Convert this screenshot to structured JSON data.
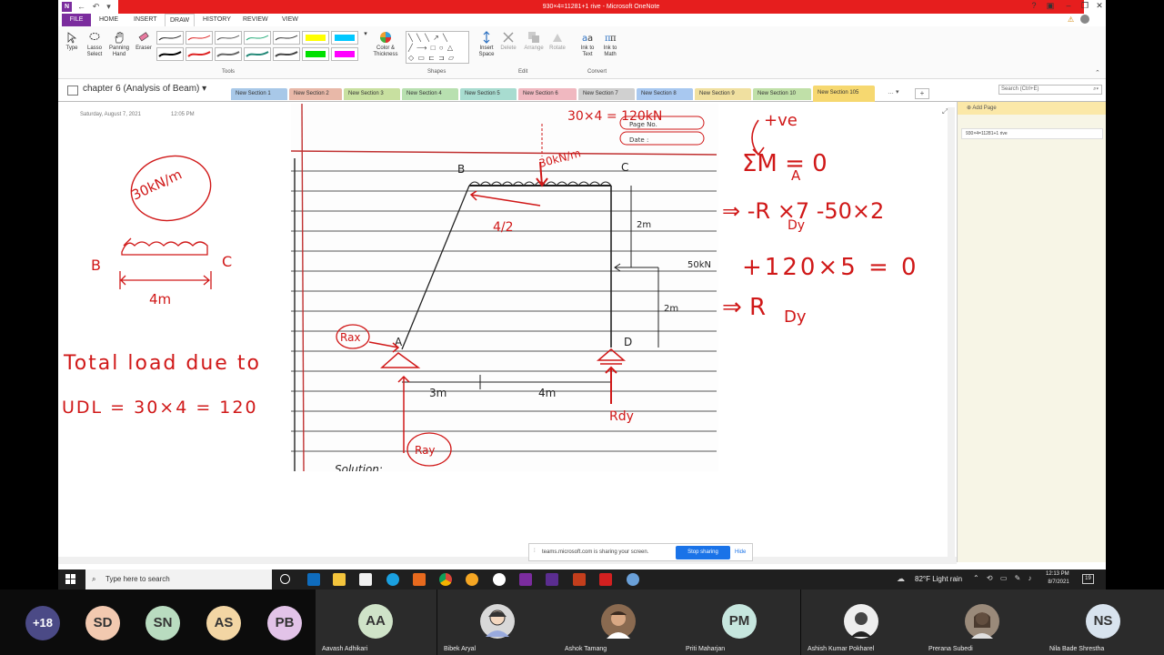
{
  "window": {
    "title": "930×4=11281+1 rive - Microsoft OneNote"
  },
  "ribbon": {
    "tabs": [
      "FILE",
      "HOME",
      "INSERT",
      "DRAW",
      "HISTORY",
      "REVIEW",
      "VIEW"
    ],
    "active_tab": "DRAW",
    "tools": {
      "type": "Type",
      "lasso": "Lasso Select",
      "panning": "Panning Hand",
      "eraser": "Eraser",
      "color_thickness": "Color & Thickness",
      "group": "Tools"
    },
    "shapes_group": "Shapes",
    "edit": {
      "insert_space": "Insert Space",
      "delete": "Delete",
      "arrange": "Arrange",
      "rotate": "Rotate",
      "group": "Edit"
    },
    "convert": {
      "ink_to_text": "Ink to Text",
      "ink_to_math": "Ink to Math",
      "group": "Convert"
    },
    "highlighter_colors": [
      "#ffff00",
      "#00c8ff",
      "#00e000",
      "#ff00ff"
    ]
  },
  "notebook": {
    "title": "chapter 6 (Analysis of Beam)",
    "sections": [
      {
        "label": "New Section 1",
        "color": "#a8c8e8"
      },
      {
        "label": "New Section 2",
        "color": "#e8b8a8"
      },
      {
        "label": "New Section 3",
        "color": "#c8e0a0"
      },
      {
        "label": "New Section 4",
        "color": "#b8e0b0"
      },
      {
        "label": "New Section 5",
        "color": "#a8dcd0"
      },
      {
        "label": "New Section 6",
        "color": "#f0b8c0"
      },
      {
        "label": "New Section 7",
        "color": "#d0d0d0"
      },
      {
        "label": "New Section 8",
        "color": "#a8c8f0"
      },
      {
        "label": "New Section 9",
        "color": "#f0e0a0"
      },
      {
        "label": "New Section 10",
        "color": "#c0e0a8"
      },
      {
        "label": "New Section 105",
        "color": "#f6d870"
      }
    ],
    "search_placeholder": "Search (Ctrl+E)"
  },
  "page": {
    "date": "Saturday, August 7, 2021",
    "time": "12:05 PM",
    "add_page": "Add Page",
    "page_item": "930×4=11281+1 rive"
  },
  "ink_notes": {
    "udl_label": "30kN/m",
    "b": "B",
    "c": "C",
    "span": "4m",
    "total_line1": "Total load due to",
    "total_line2": "UDL = 30×4 = 120",
    "eq1": "+ve",
    "eq2": "ΣM = 0",
    "eq2_sub": "A",
    "eq3": "⇒ -R  ×7 -50×2",
    "eq3_sub": "Dy",
    "eq4": "+120×5 = 0",
    "eq5": "⇒ R",
    "eq5_sub": "Dy"
  },
  "figure": {
    "top_note": "30×4 = 120kN",
    "page_no": "Page No.",
    "date_label": "Date :",
    "udl": "30kN/m",
    "B": "B",
    "C": "C",
    "A": "A",
    "D": "D",
    "half": "4/2",
    "dim1": "2m",
    "dim2": "2m",
    "load": "50kN",
    "d3": "3m",
    "d4": "4m",
    "rax": "Rax",
    "ray": "Ray",
    "rdy": "Rdy",
    "solution": "Solution:"
  },
  "sharing": {
    "text": "teams.microsoft.com is sharing your screen.",
    "stop": "Stop sharing",
    "hide": "Hide"
  },
  "taskbar": {
    "search": "Type here to search",
    "weather": "82°F  Light rain",
    "time": "12:13 PM",
    "date": "8/7/2021"
  },
  "participants": {
    "more": "+18",
    "initials": [
      {
        "initials": "SD",
        "color": "#f2c9b0"
      },
      {
        "initials": "SN",
        "color": "#b9dcc0"
      },
      {
        "initials": "AS",
        "color": "#f3d6a4"
      },
      {
        "initials": "PB",
        "color": "#e2c3e8"
      }
    ],
    "tiles": [
      {
        "name": "Aavash Adhikari",
        "initials": "AA",
        "color": "#cfe3c8"
      },
      {
        "name": "Bibek Aryal",
        "initials": "",
        "color": "#d8d8d8"
      },
      {
        "name": "Ashok Tamang",
        "initials": "",
        "color": "#8a6a50"
      },
      {
        "name": "Priti Maharjan",
        "initials": "PM",
        "color": "#c6e6de"
      },
      {
        "name": "Ashish Kumar Pokharel",
        "initials": "",
        "color": "#eeeeee"
      },
      {
        "name": "Prerana Subedi",
        "initials": "",
        "color": "#9a8a7a"
      },
      {
        "name": "Nila Bade Shrestha",
        "initials": "NS",
        "color": "#d8e3ee"
      }
    ]
  }
}
